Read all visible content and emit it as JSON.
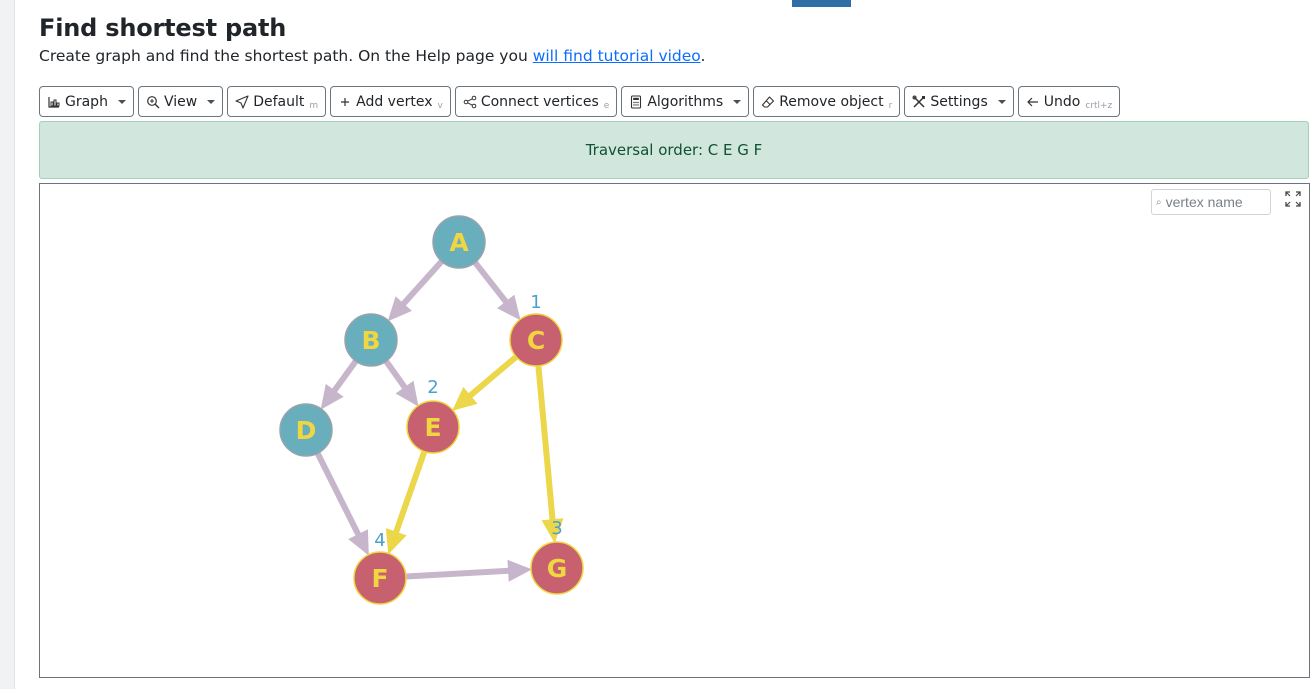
{
  "page": {
    "title": "Find shortest path",
    "subtitle_text": "Create graph and find the shortest path. On the Help page you ",
    "subtitle_link": "will find tutorial video",
    "subtitle_end": "."
  },
  "toolbar": {
    "graph": "Graph",
    "view": "View",
    "default": "Default",
    "default_shortcut": "m",
    "add_vertex": "Add vertex",
    "add_vertex_shortcut": "v",
    "connect_vertices": "Connect vertices",
    "connect_vertices_shortcut": "e",
    "algorithms": "Algorithms",
    "remove_object": "Remove object",
    "remove_object_shortcut": "r",
    "settings": "Settings",
    "undo": "Undo",
    "undo_shortcut": "crtl+z"
  },
  "status": {
    "message": "Traversal order: C E G F"
  },
  "search": {
    "placeholder": "vertex name"
  },
  "colors": {
    "vertex_default_fill": "#69aebd",
    "vertex_visited_fill": "#c8616f",
    "vertex_label": "#f0d640",
    "order_label": "#4aa2c9",
    "edge_default": "#c7b6cb",
    "edge_traversed": "#ecd64a",
    "status_bg": "#d1e7dd"
  },
  "graph": {
    "vertices": [
      {
        "id": "A",
        "label": "A",
        "visited": false
      },
      {
        "id": "B",
        "label": "B",
        "visited": false
      },
      {
        "id": "C",
        "label": "C",
        "visited": true,
        "order": "1"
      },
      {
        "id": "D",
        "label": "D",
        "visited": false
      },
      {
        "id": "E",
        "label": "E",
        "visited": true,
        "order": "2"
      },
      {
        "id": "F",
        "label": "F",
        "visited": true,
        "order": "4"
      },
      {
        "id": "G",
        "label": "G",
        "visited": true,
        "order": "3"
      }
    ],
    "edges": [
      {
        "from": "A",
        "to": "B",
        "traversed": false
      },
      {
        "from": "A",
        "to": "C",
        "traversed": false
      },
      {
        "from": "B",
        "to": "D",
        "traversed": false
      },
      {
        "from": "B",
        "to": "E",
        "traversed": false
      },
      {
        "from": "C",
        "to": "E",
        "traversed": true
      },
      {
        "from": "C",
        "to": "G",
        "traversed": true
      },
      {
        "from": "D",
        "to": "F",
        "traversed": false
      },
      {
        "from": "E",
        "to": "F",
        "traversed": true
      },
      {
        "from": "F",
        "to": "G",
        "traversed": false
      }
    ]
  }
}
